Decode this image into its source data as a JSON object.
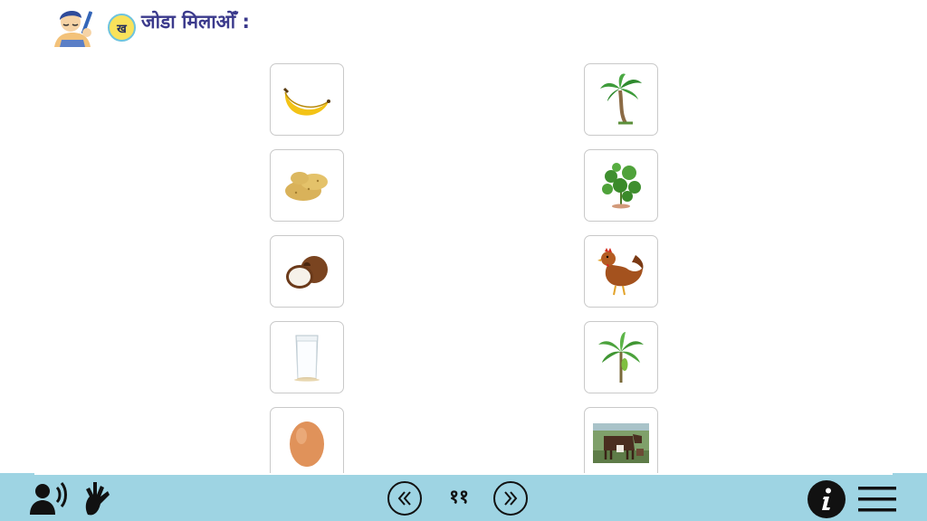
{
  "header": {
    "badge": "ख",
    "title": "जोडा मिलाओँ :"
  },
  "left_cards": [
    {
      "icon": "banana-icon"
    },
    {
      "icon": "potato-icon"
    },
    {
      "icon": "coconut-icon"
    },
    {
      "icon": "milk-glass-icon"
    },
    {
      "icon": "egg-icon"
    }
  ],
  "right_cards": [
    {
      "icon": "coconut-tree-icon"
    },
    {
      "icon": "potato-plant-icon"
    },
    {
      "icon": "hen-icon"
    },
    {
      "icon": "banana-tree-icon"
    },
    {
      "icon": "cow-icon"
    }
  ],
  "footer": {
    "page_number": "११",
    "colors": {
      "bar": "#9ed4e3"
    }
  }
}
